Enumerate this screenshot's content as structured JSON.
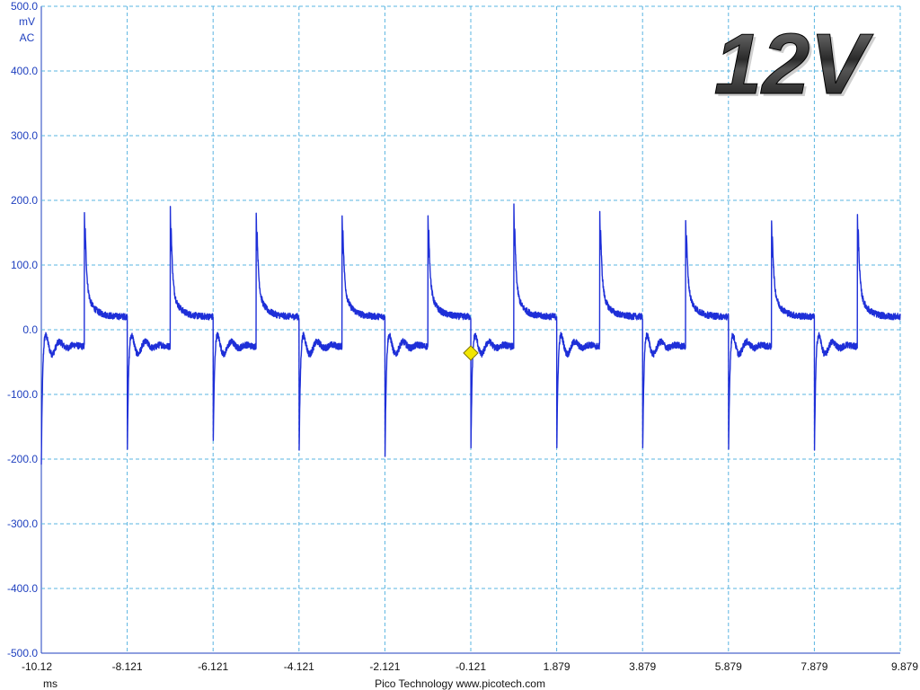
{
  "chart_data": {
    "type": "line",
    "title": "12V",
    "y_unit": "mV",
    "y_coupling": "AC",
    "x_unit": "ms",
    "footer": "Pico Technology  www.picotech.com",
    "xlim": [
      -10.121,
      9.879
    ],
    "ylim": [
      -500,
      500
    ],
    "grid": true,
    "yticks": [
      "500.0",
      "400.0",
      "300.0",
      "200.0",
      "100.0",
      "0.0",
      "-100.0",
      "-200.0",
      "-300.0",
      "-400.0",
      "-500.0"
    ],
    "xticks": [
      "-10.12",
      "-8.121",
      "-6.121",
      "-4.121",
      "-2.121",
      "-0.121",
      "1.879",
      "3.879",
      "5.879",
      "7.879",
      "9.879"
    ],
    "trigger": {
      "x": -0.121,
      "y": -36
    },
    "period_ms": 2.0,
    "series": [
      {
        "color": "#1e2fd8",
        "falling_edges_ms": [
          -10.121,
          -8.121,
          -6.121,
          -4.121,
          -2.121,
          -0.121,
          1.879,
          3.879,
          5.879,
          7.879
        ],
        "rising_edges_ms": [
          -9.121,
          -7.121,
          -5.121,
          -3.121,
          -1.121,
          0.879,
          2.879,
          4.879,
          6.879,
          8.879
        ],
        "positive_peaks_mv": [
          203,
          208,
          205,
          200,
          192,
          210,
          206,
          188,
          188,
          200
        ],
        "negative_peaks_mv": [
          -210,
          -205,
          -198,
          -215,
          -220,
          -210,
          -205,
          -210,
          -215,
          -212
        ],
        "high_level_mv": 20,
        "low_level_mv": -25
      }
    ]
  },
  "colors": {
    "trace": "#1e2fd8",
    "grid": "#5ab4e0",
    "axis": "#1e3fbf",
    "trigger": "#f2e600"
  }
}
